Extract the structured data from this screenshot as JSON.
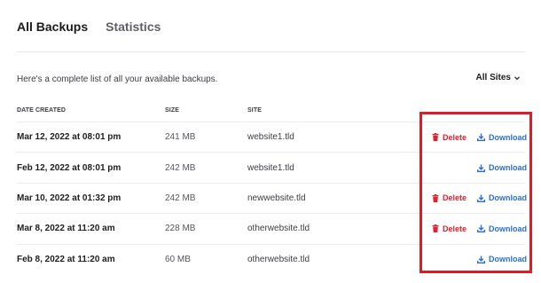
{
  "tabs": [
    {
      "label": "All Backups",
      "active": true
    },
    {
      "label": "Statistics",
      "active": false
    }
  ],
  "intro_text": "Here's a complete list of all your available backups.",
  "filter": {
    "label": "All Sites",
    "icon": "chevron-down-icon"
  },
  "columns": {
    "date": "DATE CREATED",
    "size": "SIZE",
    "site": "SITE"
  },
  "actions": {
    "delete_label": "Delete",
    "download_label": "Download",
    "delete_icon": "trash-icon",
    "download_icon": "download-icon"
  },
  "rows": [
    {
      "date": "Mar 12, 2022 at 08:01 pm",
      "size": "241 MB",
      "site": "website1.tld",
      "can_delete": true
    },
    {
      "date": "Feb 12, 2022 at 08:01 pm",
      "size": "242 MB",
      "site": "website1.tld",
      "can_delete": false
    },
    {
      "date": "Mar 10, 2022 at 01:32 pm",
      "size": "242 MB",
      "site": "newwebsite.tld",
      "can_delete": true
    },
    {
      "date": "Mar 8, 2022 at 11:20 am",
      "size": "228 MB",
      "site": "otherwebsite.tld",
      "can_delete": true
    },
    {
      "date": "Feb 8, 2022 at 11:20 am",
      "size": "60 MB",
      "site": "otherwebsite.tld",
      "can_delete": false
    }
  ],
  "colors": {
    "delete": "#e5202e",
    "download": "#2a6fd6",
    "highlight": "#e01b24"
  }
}
